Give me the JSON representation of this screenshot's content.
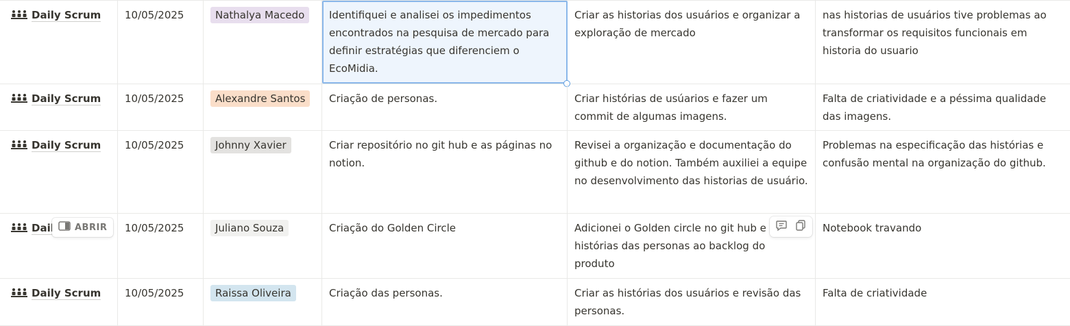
{
  "colors": {
    "tag_purple": "#e8deee",
    "tag_orange": "#fadec9",
    "tag_gray": "#e3e2e0",
    "tag_lightgray": "#f1f1ef",
    "tag_blue": "#d3e5ef"
  },
  "icons": {
    "title": "meeting-people-icon",
    "open": "side-peek-icon",
    "comment": "comment-icon",
    "copy": "copy-icon"
  },
  "open_label": "ABRIR",
  "rows": [
    {
      "title": "Daily Scrum",
      "date": "10/05/2025",
      "person": "Nathalya Macedo",
      "did": "Identifiquei e analisei os impedimentos encontrados na pesquisa de mercado para definir estratégias que diferenciem o EcoMidia.",
      "will": "Criar as historias dos usuários e organizar a exploração de mercado",
      "blockers": "nas historias de usuários tive problemas ao transformar os requisitos funcionais em historia do usuario"
    },
    {
      "title": "Daily Scrum",
      "date": "10/05/2025",
      "person": "Alexandre Santos",
      "did": "Criação de personas.",
      "will": "Criar histórias de usúarios e fazer um commit de algumas imagens.",
      "blockers": "Falta de criatividade e a péssima qualidade das imagens."
    },
    {
      "title": "Daily Scrum",
      "date": "10/05/2025",
      "person": "Johnny Xavier",
      "did": "Criar repositório no git hub e as páginas no notion.",
      "will": "Revisei a organização e documentação do github e do notion. Também auxiliei a equipe no desenvolvimento das historias de usuário.",
      "blockers": "Problemas na especificação das histórias e confusão mental na organização do github."
    },
    {
      "title": "Dail",
      "date": "10/05/2025",
      "person": "Juliano Souza",
      "did": "Criação do Golden Circle",
      "will": "Adicionei  o Golden circle no git hub e histórias das personas ao backlog do produto",
      "blockers": "Notebook travando"
    },
    {
      "title": "Daily Scrum",
      "date": "10/05/2025",
      "person": "Raissa Oliveira",
      "did": "Criação das personas.",
      "will": "Criar as histórias dos usuários e revisão das personas.",
      "blockers": "Falta de criatividade"
    }
  ]
}
